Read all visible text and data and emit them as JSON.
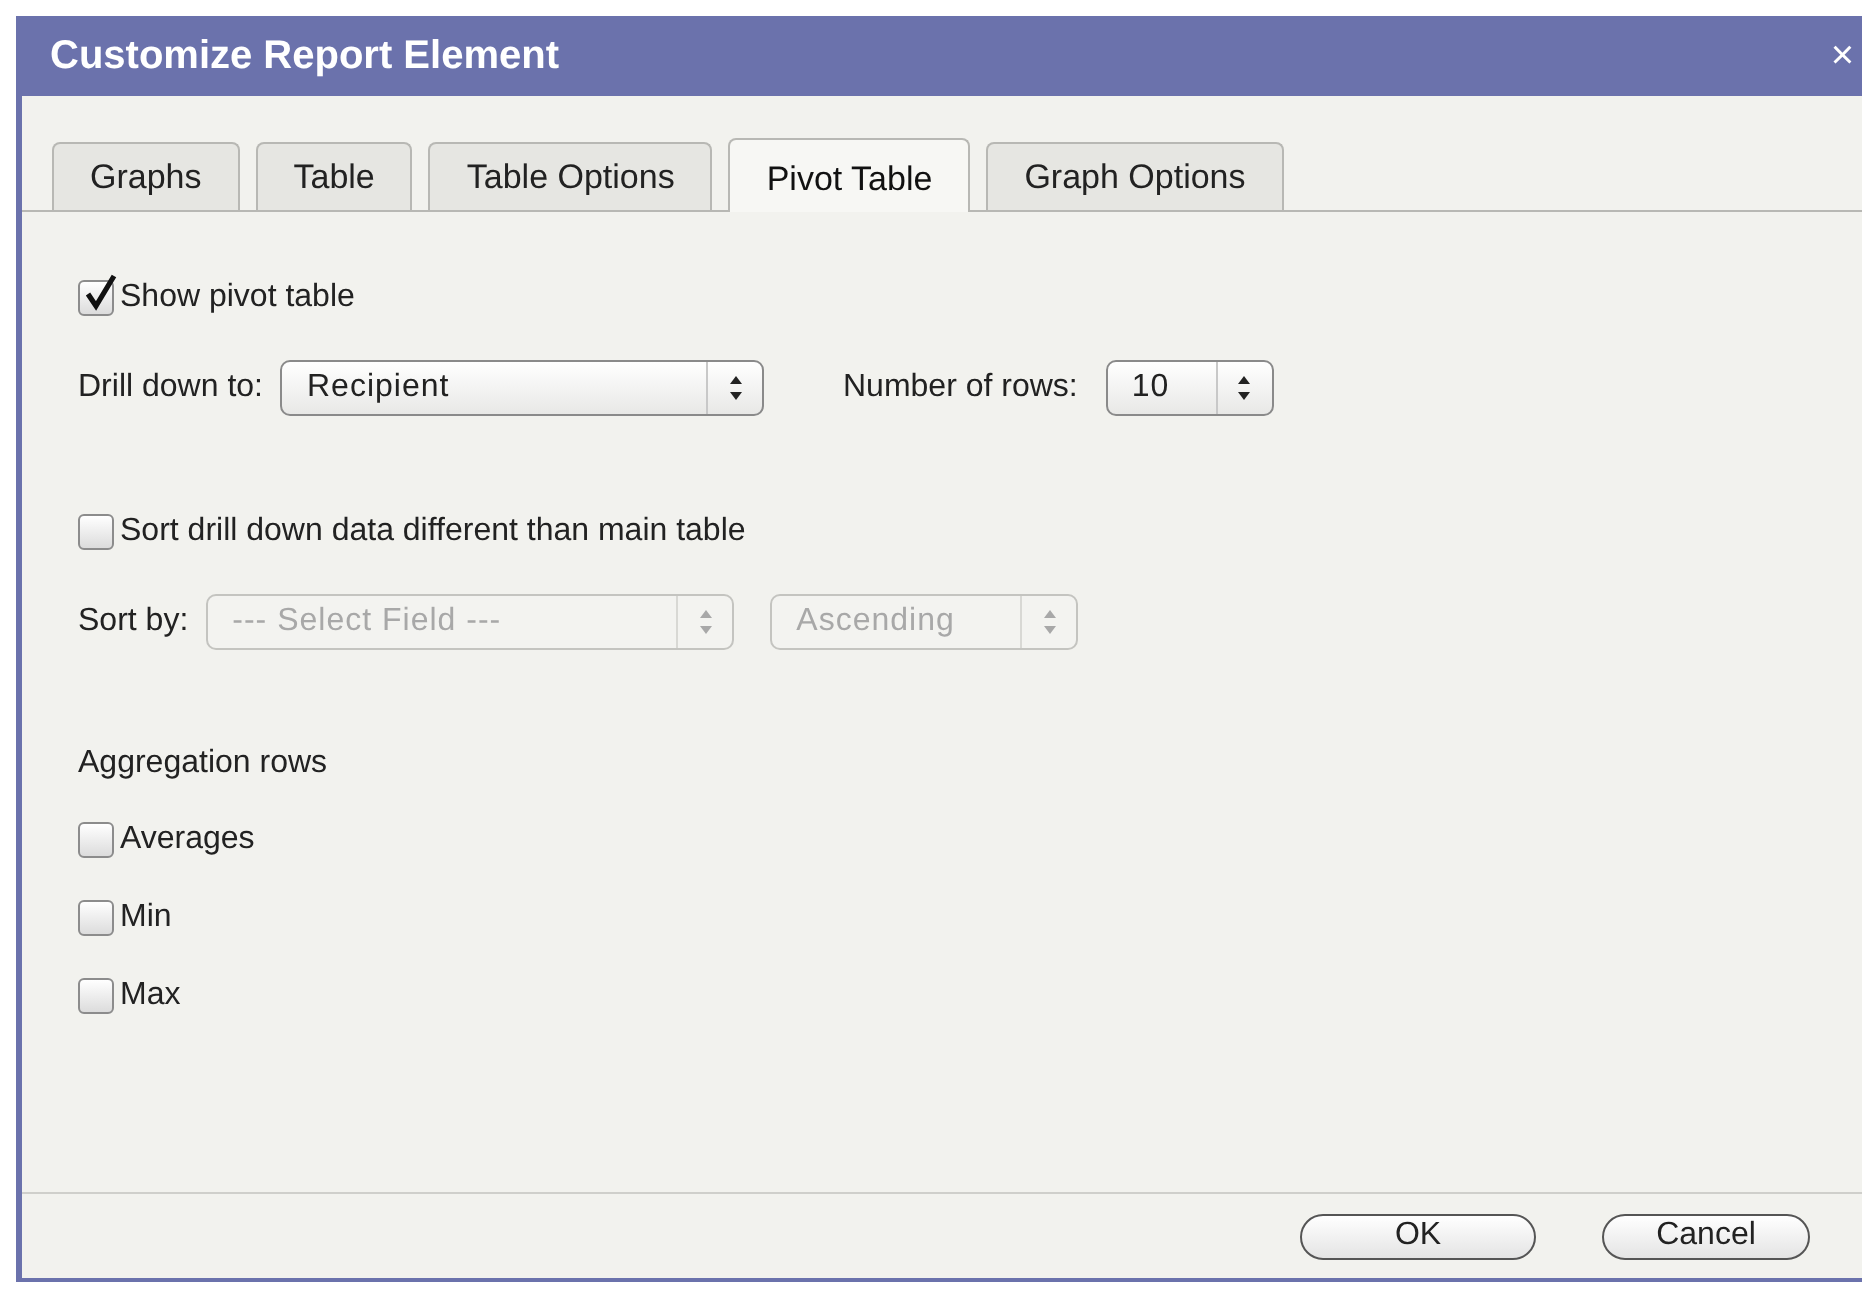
{
  "window": {
    "title": "Customize Report Element",
    "close": "×"
  },
  "tabs": [
    {
      "label": "Graphs",
      "selected": false
    },
    {
      "label": "Table",
      "selected": false
    },
    {
      "label": "Table Options",
      "selected": false
    },
    {
      "label": "Pivot Table",
      "selected": true
    },
    {
      "label": "Graph Options",
      "selected": false
    }
  ],
  "show_pivot": {
    "label": "Show pivot table",
    "checked": true
  },
  "drill_down": {
    "label": "Drill down to:",
    "value": "Recipient",
    "disabled": false
  },
  "number_of_rows": {
    "label": "Number of rows:",
    "value": "10",
    "disabled": false
  },
  "sort_different": {
    "label": "Sort drill down data different than main table",
    "checked": false
  },
  "sort_by": {
    "label": "Sort by:",
    "field": {
      "value": "--- Select Field ---",
      "disabled": true
    },
    "order": {
      "value": "Ascending",
      "disabled": true
    }
  },
  "aggregation": {
    "heading": "Aggregation rows",
    "options": [
      {
        "label": "Averages",
        "checked": false
      },
      {
        "label": "Min",
        "checked": false
      },
      {
        "label": "Max",
        "checked": false
      }
    ]
  },
  "buttons": [
    "OK",
    "Cancel"
  ]
}
